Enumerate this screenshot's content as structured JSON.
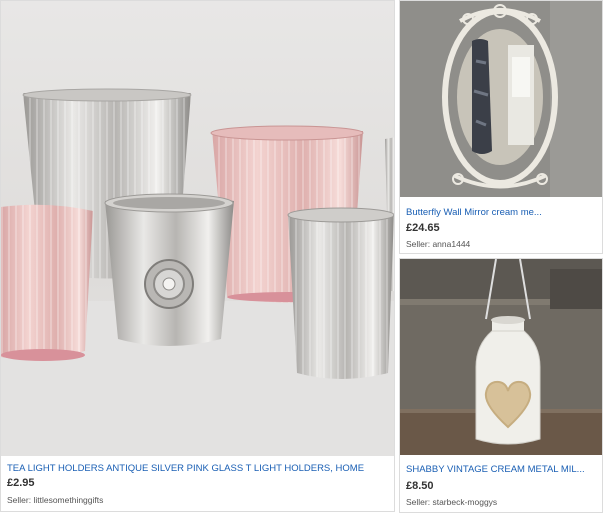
{
  "listings": [
    {
      "title": "TEA LIGHT HOLDERS ANTIQUE SILVER PINK GLASS T LIGHT HOLDERS, HOME",
      "price": "£2.95",
      "seller": "Seller: littlesomethinggifts",
      "image": "tea-light-holders-photo"
    },
    {
      "title": "Butterfly Wall Mirror cream me...",
      "price": "£24.65",
      "seller": "Seller: anna1444",
      "image": "butterfly-mirror-photo"
    },
    {
      "title": "SHABBY VINTAGE CREAM METAL MIL...",
      "price": "£8.50",
      "seller": "Seller: starbeck-moggys",
      "image": "cream-milk-churn-lantern-photo"
    }
  ],
  "colors": {
    "link": "#1a5fb4",
    "price": "#333333",
    "seller": "#555555",
    "card_border": "#dcdcdc"
  }
}
